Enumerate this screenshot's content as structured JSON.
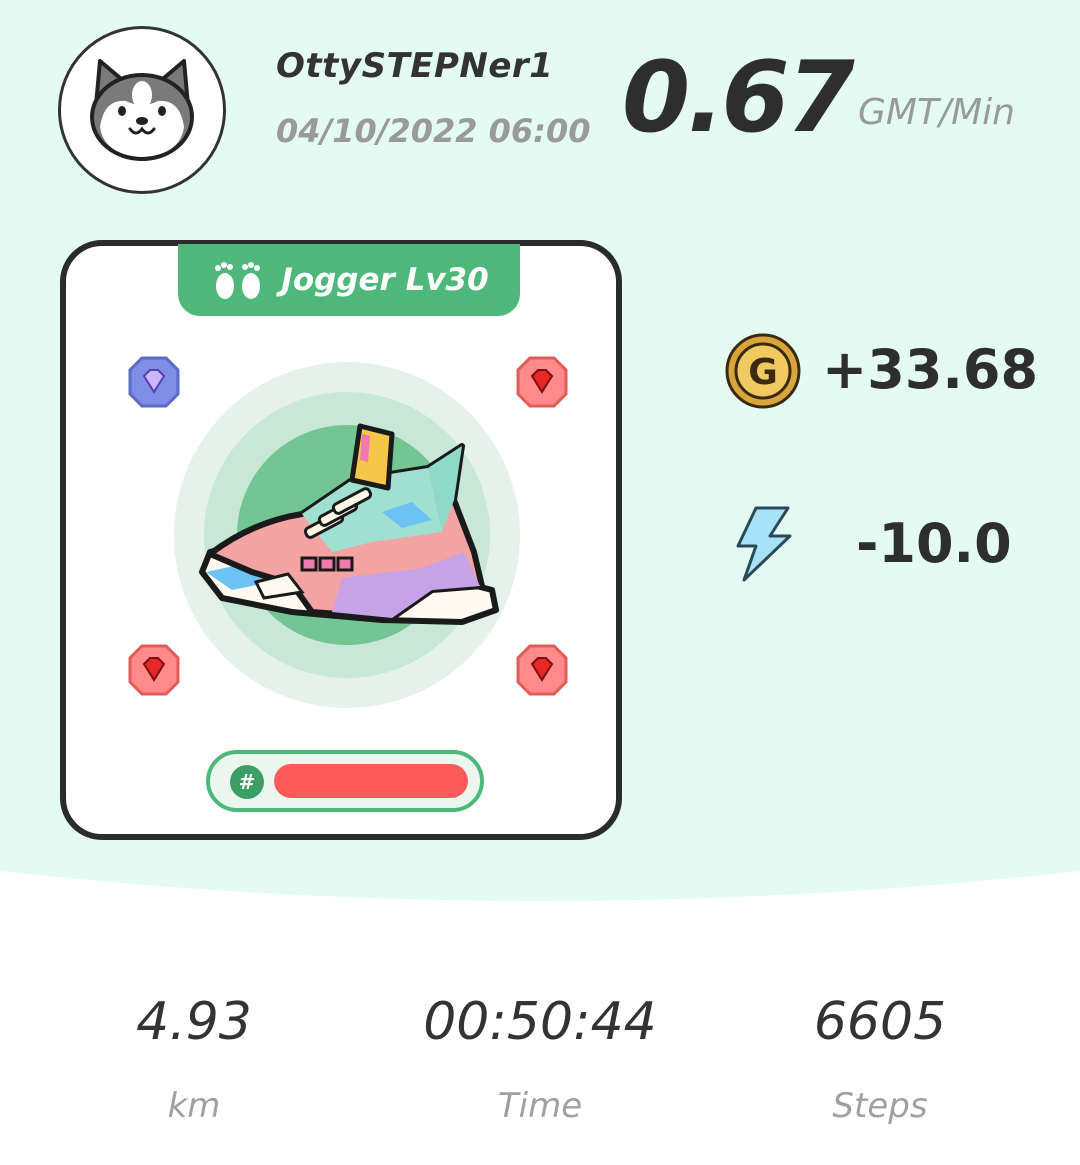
{
  "user": {
    "username": "OttySTEPNer1",
    "datetime": "04/10/2022 06:00",
    "avatar_icon": "shiba-dog-avatar"
  },
  "rate": {
    "value": "0.67",
    "unit": "GMT/Min"
  },
  "sneaker": {
    "type_label": "Jogger Lv30",
    "type_icon": "footprints-icon",
    "id_prefix": "#",
    "gem_sockets": [
      {
        "slot": "top-left",
        "gem": "comfort-gem",
        "color": "#7f8de6"
      },
      {
        "slot": "top-right",
        "gem": "efficiency-gem",
        "color": "#ff7b7b"
      },
      {
        "slot": "bottom-left",
        "gem": "efficiency-gem",
        "color": "#ff7b7b"
      },
      {
        "slot": "bottom-right",
        "gem": "efficiency-gem",
        "color": "#ff7b7b"
      }
    ]
  },
  "earnings": {
    "gst": "+33.68",
    "gst_icon": "gst-coin-icon",
    "energy": "-10.0",
    "energy_icon": "lightning-icon"
  },
  "metrics": [
    {
      "value": "4.93",
      "label": "km"
    },
    {
      "value": "00:50:44",
      "label": "Time"
    },
    {
      "value": "6605",
      "label": "Steps"
    }
  ],
  "colors": {
    "accent": "#4db87a",
    "background": "#e3fbf3",
    "text_dark": "#2e2e2e",
    "text_muted": "#9a9a9a"
  }
}
